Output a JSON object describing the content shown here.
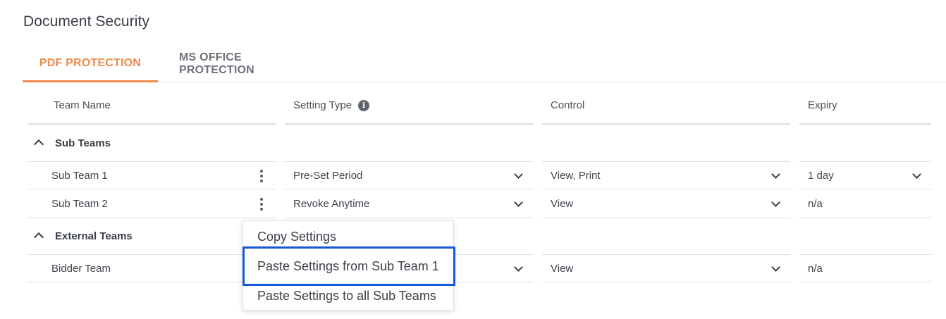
{
  "page": {
    "title": "Document Security"
  },
  "tabs": [
    {
      "label": "PDF PROTECTION",
      "active": true
    },
    {
      "label": "MS OFFICE PROTECTION",
      "active": false
    }
  ],
  "columns": {
    "team_name": "Team Name",
    "setting_type": "Setting Type",
    "control": "Control",
    "expiry": "Expiry"
  },
  "groups": {
    "sub_teams": {
      "label": "Sub Teams",
      "rows": [
        {
          "team": "Sub Team 1",
          "setting_type": "Pre-Set Period",
          "control": "View, Print",
          "expiry": "1 day"
        },
        {
          "team": "Sub Team 2",
          "setting_type": "Revoke Anytime",
          "control": "View",
          "expiry": "n/a"
        }
      ]
    },
    "external_teams": {
      "label": "External Teams",
      "rows": [
        {
          "team": "Bidder Team",
          "setting_type": "",
          "control": "View",
          "expiry": "n/a"
        }
      ]
    }
  },
  "context_menu": {
    "items": [
      "Copy Settings",
      "Paste Settings from Sub Team 1",
      "Paste Settings to all Sub Teams"
    ],
    "highlighted_index": 1
  },
  "colors": {
    "accent": "#ef8a48",
    "highlight_border": "#1557d9"
  }
}
